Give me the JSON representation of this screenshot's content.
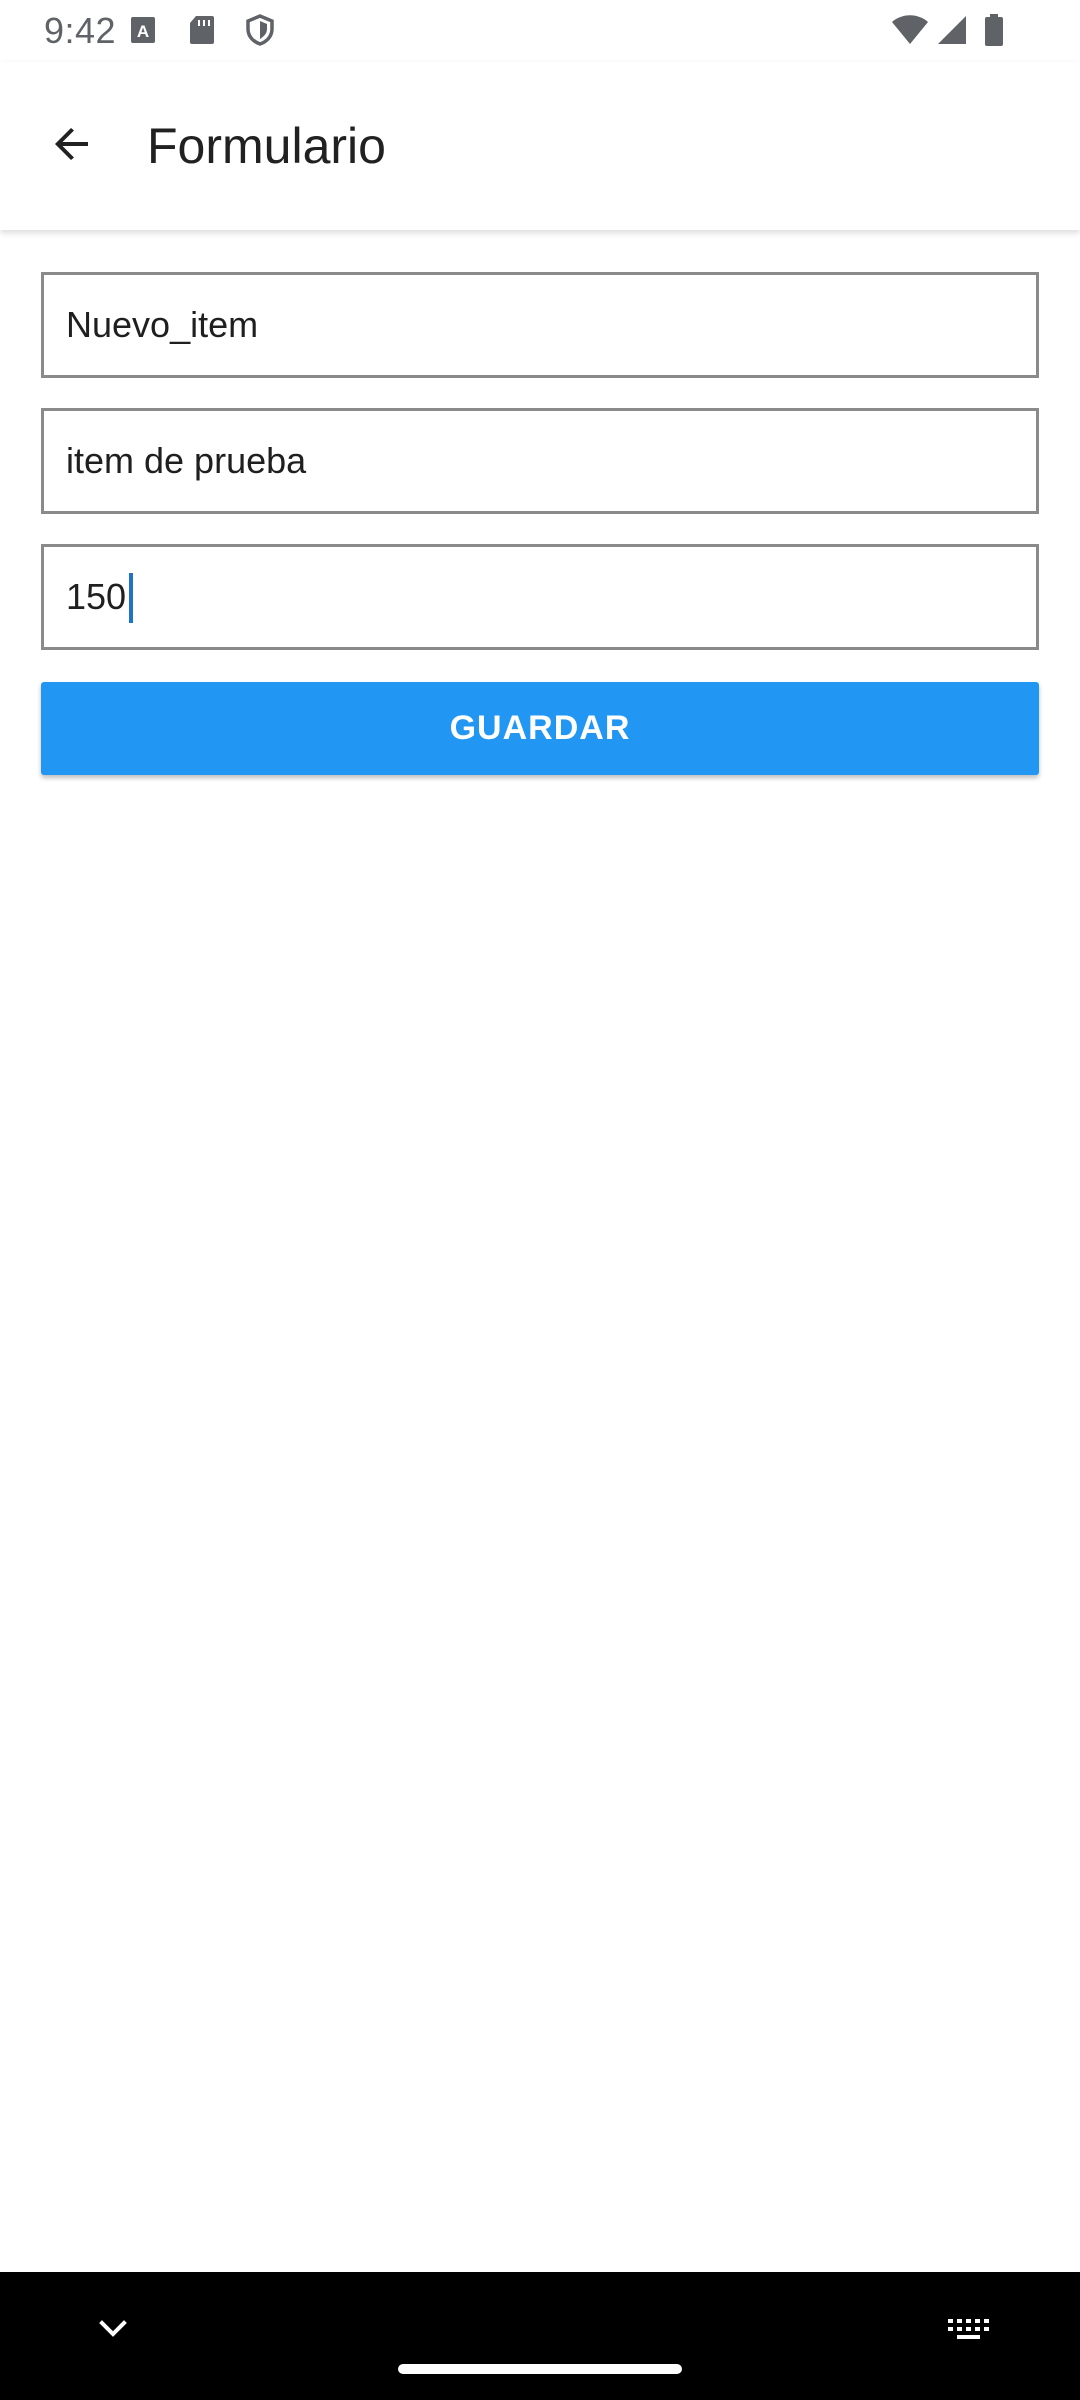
{
  "status_bar": {
    "time": "9:42",
    "left_icons": [
      "text-a-icon",
      "sd-card-icon",
      "shield-icon"
    ],
    "right_icons": [
      "wifi-icon",
      "signal-icon",
      "battery-icon"
    ]
  },
  "app_bar": {
    "title": "Formulario",
    "back_icon": "arrow-back-icon"
  },
  "form": {
    "fields": [
      {
        "value": "Nuevo_item"
      },
      {
        "value": "item de prueba"
      },
      {
        "value": "150"
      }
    ],
    "save_label": "GUARDAR"
  },
  "nav_bar": {
    "icons": [
      "chevron-down-icon",
      "keyboard-icon"
    ]
  },
  "colors": {
    "accent": "#2196f3",
    "caret": "#1e74c7",
    "field_border": "#8a8a8a"
  }
}
